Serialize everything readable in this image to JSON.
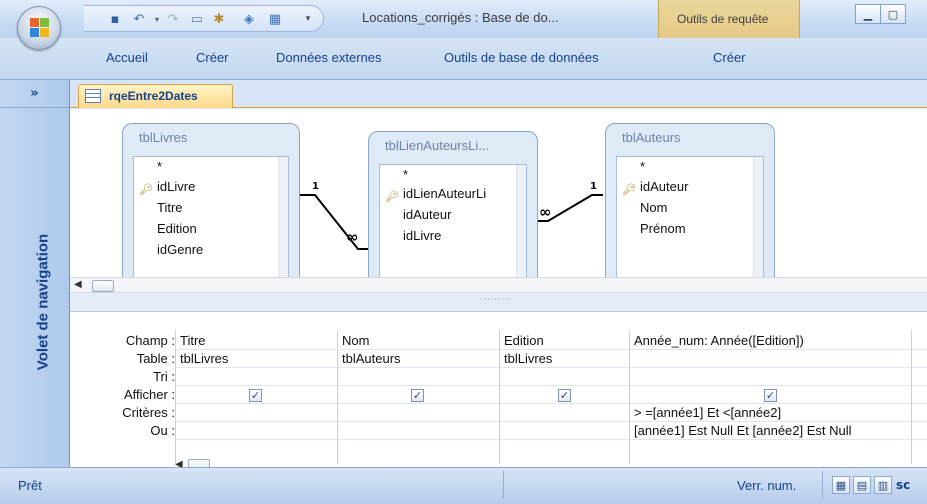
{
  "window": {
    "title": "Locations_corrigés : Base de do...",
    "context_tab_title": "Outils de requête"
  },
  "ribbon": {
    "tabs": [
      "Accueil",
      "Créer",
      "Données externes",
      "Outils de base de données",
      "Créer"
    ]
  },
  "nav_pane": {
    "toggle": "»",
    "label": "Volet de navigation"
  },
  "document_tab": {
    "label": "rqeEntre2Dates"
  },
  "diagram": {
    "tables": [
      {
        "name": "tblLivres",
        "fields": [
          "*",
          "idLivre",
          "Titre",
          "Edition",
          "idGenre"
        ],
        "key_field": "idLivre"
      },
      {
        "name": "tblLienAuteursLi...",
        "fields": [
          "*",
          "idLienAuteurLi",
          "idAuteur",
          "idLivre"
        ],
        "key_field": "idLienAuteurLi"
      },
      {
        "name": "tblAuteurs",
        "fields": [
          "*",
          "idAuteur",
          "Nom",
          "Prénom"
        ],
        "key_field": "idAuteur"
      }
    ],
    "relations": [
      {
        "one": "1",
        "many": "∞"
      },
      {
        "one": "1",
        "many": "∞"
      }
    ],
    "splitter_dots": "·········"
  },
  "query_grid": {
    "row_labels": [
      "Champ :",
      "Table :",
      "Tri :",
      "Afficher :",
      "Critères :",
      "Ou :"
    ],
    "columns": [
      {
        "champ": "Titre",
        "table": "tblLivres",
        "tri": "",
        "afficher": true,
        "criteres": "",
        "ou": ""
      },
      {
        "champ": "Nom",
        "table": "tblAuteurs",
        "tri": "",
        "afficher": true,
        "criteres": "",
        "ou": ""
      },
      {
        "champ": "Edition",
        "table": "tblLivres",
        "tri": "",
        "afficher": true,
        "criteres": "",
        "ou": ""
      },
      {
        "champ": "Année_num: Année([Edition])",
        "table": "",
        "tri": "",
        "afficher": true,
        "criteres": "> =[année1] Et <[année2]",
        "ou": "[année1] Est Null Et [année2] Est Null"
      }
    ],
    "check_glyph": "✓"
  },
  "status_bar": {
    "left": "Prêt",
    "numlock": "Verr. num.",
    "truncated": "sc"
  }
}
